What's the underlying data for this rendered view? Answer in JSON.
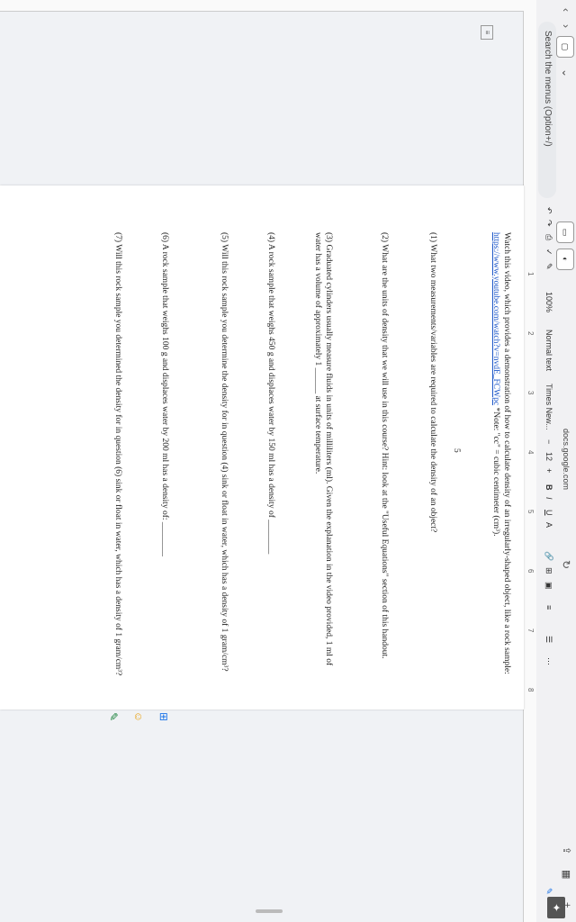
{
  "browser": {
    "url": "docs.google.com",
    "tabs_count": "1",
    "share_icon": "share-icon"
  },
  "menus": {
    "search_placeholder": "Search the menus (Option+/)"
  },
  "toolbar": {
    "zoom": "100%",
    "style": "Normal text",
    "font": "Times New...",
    "font_size": "12",
    "minus": "−",
    "plus": "+",
    "bold": "B",
    "italic": "I",
    "underline": "U",
    "text_color": "A",
    "more": "⋯",
    "undo": "↶",
    "redo": "↷"
  },
  "ruler": {
    "marks": [
      "1",
      "2",
      "3",
      "4",
      "5",
      "6",
      "7",
      "8"
    ]
  },
  "doc": {
    "intro_pre": "Watch this video, which provides a demonstration of how to calculate density of an irregularly-shaped object, like a rock sample: ",
    "intro_link": "https://www.youtube.com/watch?v=nvdE_FCWpc",
    "intro_post": " *Note: \"cc\" = cubic centimeter (cm³).",
    "page_num": "5",
    "q1": "(1) What two measurements/variables are required to calculate the density of an object?",
    "q2": "(2) What are the units of density that we will use in this course? Hint: look at the \"Useful Equations\" section of this handout.",
    "q3": "(3) Graduated cylinders usually measure fluids in units of milliliters (ml). Given the explanation in the video provided, 1 ml of water has a volume of approximately 1 ______ at surface temperature.",
    "q4": "(4) A rock sample that weighs 450 g and displaces water by 150 ml has a density of ________",
    "q5": "(5) Will this rock sample you determine the density for in question (4) sink or float in water, which has a density of 1 gram/cm³?",
    "q6": "(6) A rock sample that weighs 100 g and displaces water by 200 ml has a density of: ________",
    "q7": "(7) Will this rock sample you determined the density for in question (6) sink or float in water, which has a density of 1 gram/cm³?"
  }
}
